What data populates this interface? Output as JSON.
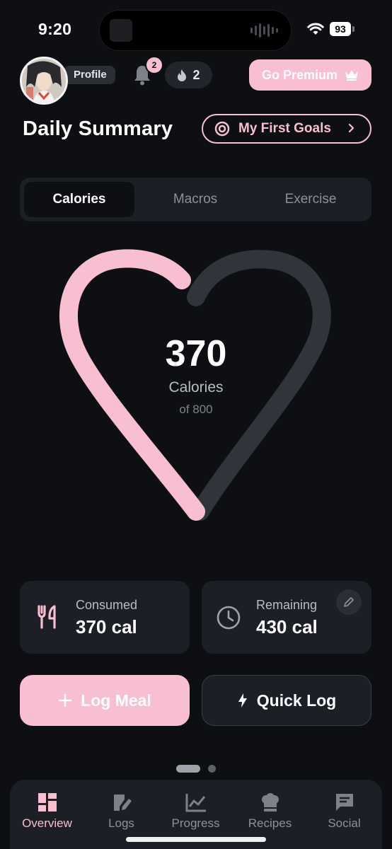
{
  "status_bar": {
    "time": "9:20",
    "battery": "93"
  },
  "header": {
    "profile_label": "Profile",
    "notification_count": "2",
    "streak_count": "2",
    "premium_label": "Go Premium"
  },
  "summary": {
    "title": "Daily Summary",
    "goals_label": "My First Goals"
  },
  "tabs": [
    {
      "label": "Calories",
      "active": true
    },
    {
      "label": "Macros",
      "active": false
    },
    {
      "label": "Exercise",
      "active": false
    }
  ],
  "progress": {
    "value": "370",
    "unit": "Calories",
    "goal_text": "of 800",
    "fraction": 0.4625
  },
  "cards": {
    "consumed": {
      "label": "Consumed",
      "value": "370 cal"
    },
    "remaining": {
      "label": "Remaining",
      "value": "430 cal"
    }
  },
  "actions": {
    "log_meal": "Log Meal",
    "quick_log": "Quick Log"
  },
  "nav": [
    {
      "label": "Overview",
      "icon": "dashboard-icon",
      "active": true
    },
    {
      "label": "Logs",
      "icon": "logs-icon",
      "active": false
    },
    {
      "label": "Progress",
      "icon": "chart-icon",
      "active": false
    },
    {
      "label": "Recipes",
      "icon": "chef-hat-icon",
      "active": false
    },
    {
      "label": "Social",
      "icon": "chat-icon",
      "active": false
    }
  ],
  "colors": {
    "accent": "#f7bfd0",
    "background": "#0e0f12",
    "card": "#1c1f25",
    "track": "#30343b"
  }
}
